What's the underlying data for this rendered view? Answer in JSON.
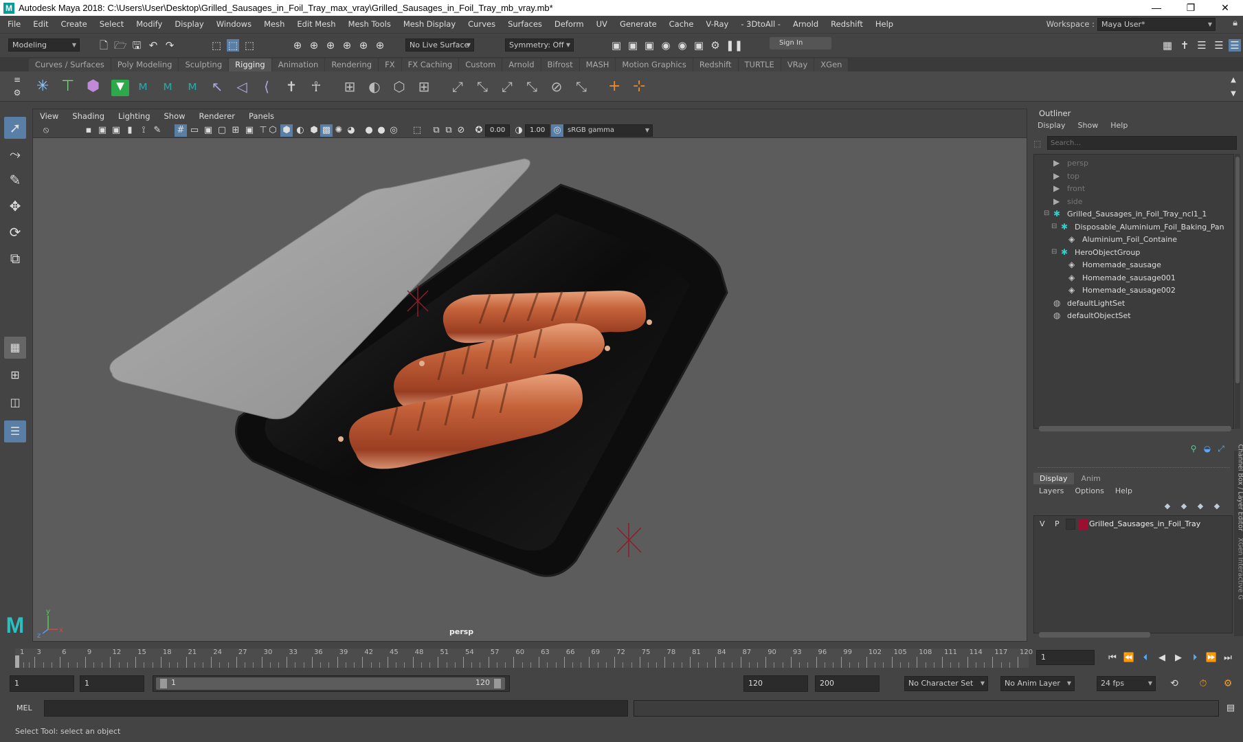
{
  "window": {
    "title": "Autodesk Maya 2018: C:\\Users\\User\\Desktop\\Grilled_Sausages_in_Foil_Tray_max_vray\\Grilled_Sausages_in_Foil_Tray_mb_vray.mb*",
    "logo": "M",
    "minimize": "—",
    "maximize": "❐",
    "close": "✕"
  },
  "menubar": {
    "items": [
      "File",
      "Edit",
      "Create",
      "Select",
      "Modify",
      "Display",
      "Windows",
      "Mesh",
      "Edit Mesh",
      "Mesh Tools",
      "Mesh Display",
      "Curves",
      "Surfaces",
      "Deform",
      "UV",
      "Generate",
      "Cache",
      "V-Ray",
      "- 3DtoAll -",
      "Arnold",
      "Redshift",
      "Help"
    ],
    "workspace_label": "Workspace :",
    "workspace_value": "Maya User*"
  },
  "statusline": {
    "mode": "Modeling",
    "live_surface": "No Live Surface",
    "symmetry": "Symmetry: Off",
    "sign_in": "Sign In"
  },
  "shelf_tabs": [
    "Curves / Surfaces",
    "Poly Modeling",
    "Sculpting",
    "Rigging",
    "Animation",
    "Rendering",
    "FX",
    "FX Caching",
    "Custom",
    "Arnold",
    "Bifrost",
    "MASH",
    "Motion Graphics",
    "Redshift",
    "TURTLE",
    "VRay",
    "XGen"
  ],
  "shelf_active": "Rigging",
  "viewport": {
    "menus": [
      "View",
      "Shading",
      "Lighting",
      "Show",
      "Renderer",
      "Panels"
    ],
    "exposure": "0.00",
    "gamma": "1.00",
    "color_space": "sRGB gamma",
    "camera_label": "persp"
  },
  "outliner": {
    "title": "Outliner",
    "menus": [
      "Display",
      "Show",
      "Help"
    ],
    "search_placeholder": "Search...",
    "items": [
      {
        "label": "persp",
        "depth": 0,
        "dim": true,
        "icon": "camera-icon"
      },
      {
        "label": "top",
        "depth": 0,
        "dim": true,
        "icon": "camera-icon"
      },
      {
        "label": "front",
        "depth": 0,
        "dim": true,
        "icon": "camera-icon"
      },
      {
        "label": "side",
        "depth": 0,
        "dim": true,
        "icon": "camera-icon"
      },
      {
        "label": "Grilled_Sausages_in_Foil_Tray_ncl1_1",
        "depth": 0,
        "dim": false,
        "icon": "group-icon"
      },
      {
        "label": "Disposable_Aluminium_Foil_Baking_Pan",
        "depth": 1,
        "dim": false,
        "icon": "group-icon"
      },
      {
        "label": "Aluminium_Foil_Containe",
        "depth": 2,
        "dim": false,
        "icon": "mesh-icon"
      },
      {
        "label": "HeroObjectGroup",
        "depth": 1,
        "dim": false,
        "icon": "group-icon"
      },
      {
        "label": "Homemade_sausage",
        "depth": 2,
        "dim": false,
        "icon": "mesh-icon"
      },
      {
        "label": "Homemade_sausage001",
        "depth": 2,
        "dim": false,
        "icon": "mesh-icon"
      },
      {
        "label": "Homemade_sausage002",
        "depth": 2,
        "dim": false,
        "icon": "mesh-icon"
      },
      {
        "label": "defaultLightSet",
        "depth": 0,
        "dim": false,
        "icon": "set-icon"
      },
      {
        "label": "defaultObjectSet",
        "depth": 0,
        "dim": false,
        "icon": "set-icon"
      }
    ]
  },
  "layer_editor": {
    "tabs": [
      "Display",
      "Anim"
    ],
    "menus": [
      "Layers",
      "Options",
      "Help"
    ],
    "layer": {
      "v": "V",
      "p": "P",
      "name": "Grilled_Sausages_in_Foil_Tray",
      "color": "#9b1030"
    },
    "side_label_1": "Channel Box / Layer Editor",
    "side_label_2": "XGen Interactive G"
  },
  "timeline": {
    "ticks": [
      "1",
      "3",
      "6",
      "9",
      "12",
      "15",
      "18",
      "21",
      "24",
      "27",
      "30",
      "33",
      "36",
      "39",
      "42",
      "45",
      "48",
      "51",
      "54",
      "57",
      "60",
      "63",
      "66",
      "69",
      "72",
      "75",
      "78",
      "81",
      "84",
      "87",
      "90",
      "93",
      "96",
      "99",
      "102",
      "105",
      "108",
      "111",
      "114",
      "117",
      "120"
    ],
    "current_frame": "1"
  },
  "range": {
    "start": "1",
    "playback_start": "1",
    "slider_start": "1",
    "slider_end": "120",
    "playback_end": "120",
    "end": "200",
    "character_set": "No Character Set",
    "anim_layer": "No Anim Layer",
    "fps": "24 fps"
  },
  "mel": {
    "label": "MEL"
  },
  "help_line": "Select Tool: select an object",
  "colors": {
    "accent": "#5aa0d8",
    "tray": "#111111",
    "lid": "#9e9e9e",
    "sausage": "#c0603a"
  }
}
